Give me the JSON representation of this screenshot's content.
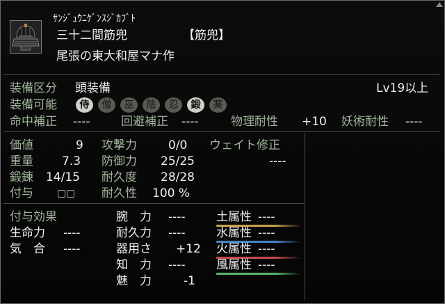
{
  "item": {
    "reading": "ｻﾝｼﾞｭｳﾆｹﾞﾝｽｼﾞｶﾌﾞﾄ",
    "name": "三十二間筋兜",
    "category": "【筋兜】",
    "maker": "尾張の東大和屋マナ作"
  },
  "equip": {
    "slot_label": "装備区分",
    "slot_value": "頭装備",
    "level": "Lv19以上",
    "allowed_label": "装備可能",
    "classes": [
      {
        "label": "侍",
        "on": true
      },
      {
        "label": "僧",
        "on": false
      },
      {
        "label": "巫",
        "on": false
      },
      {
        "label": "陰",
        "on": false
      },
      {
        "label": "忍",
        "on": false
      },
      {
        "label": "鍛",
        "on": true
      },
      {
        "label": "薬",
        "on": false
      }
    ]
  },
  "mods": {
    "hit_label": "命中補正",
    "hit_value": "----",
    "evade_label": "回避補正",
    "evade_value": "----",
    "phys_label": "物理耐性",
    "phys_value": "+10",
    "magic_label": "妖術耐性",
    "magic_value": "----"
  },
  "stats": {
    "price_label": "価値",
    "price_value": "9",
    "weight_label": "重量",
    "weight_value": "7.3",
    "forge_label": "鍛錬",
    "forge_value": "14/15",
    "enchant_label": "付与",
    "attack_label": "攻撃力",
    "attack_value": "0/0",
    "defense_label": "防御力",
    "defense_value": "25/25",
    "durability_label": "耐久度",
    "durability_value": "28/28",
    "durability_stat_label": "耐久性",
    "durability_stat_value": "100 %",
    "wait_label": "ウェイト修正",
    "wait_value": "----"
  },
  "effects": {
    "title": "付与効果",
    "left": [
      {
        "label": "生命力",
        "value": "----"
      },
      {
        "label": "気　合",
        "value": "----"
      }
    ],
    "middle": [
      {
        "label": "腕　力",
        "value": "----"
      },
      {
        "label": "耐久力",
        "value": "----"
      },
      {
        "label": "器用さ",
        "value": "+12"
      },
      {
        "label": "知　力",
        "value": "----"
      },
      {
        "label": "魅　力",
        "value": "-1"
      }
    ],
    "elements": [
      {
        "label": "土属性",
        "value": "----",
        "color": "#c8a24a"
      },
      {
        "label": "水属性",
        "value": "----",
        "color": "#4a86c8"
      },
      {
        "label": "火属性",
        "value": "----",
        "color": "#c84a4a"
      },
      {
        "label": "風属性",
        "value": "----",
        "color": "#5ab86a"
      }
    ]
  }
}
